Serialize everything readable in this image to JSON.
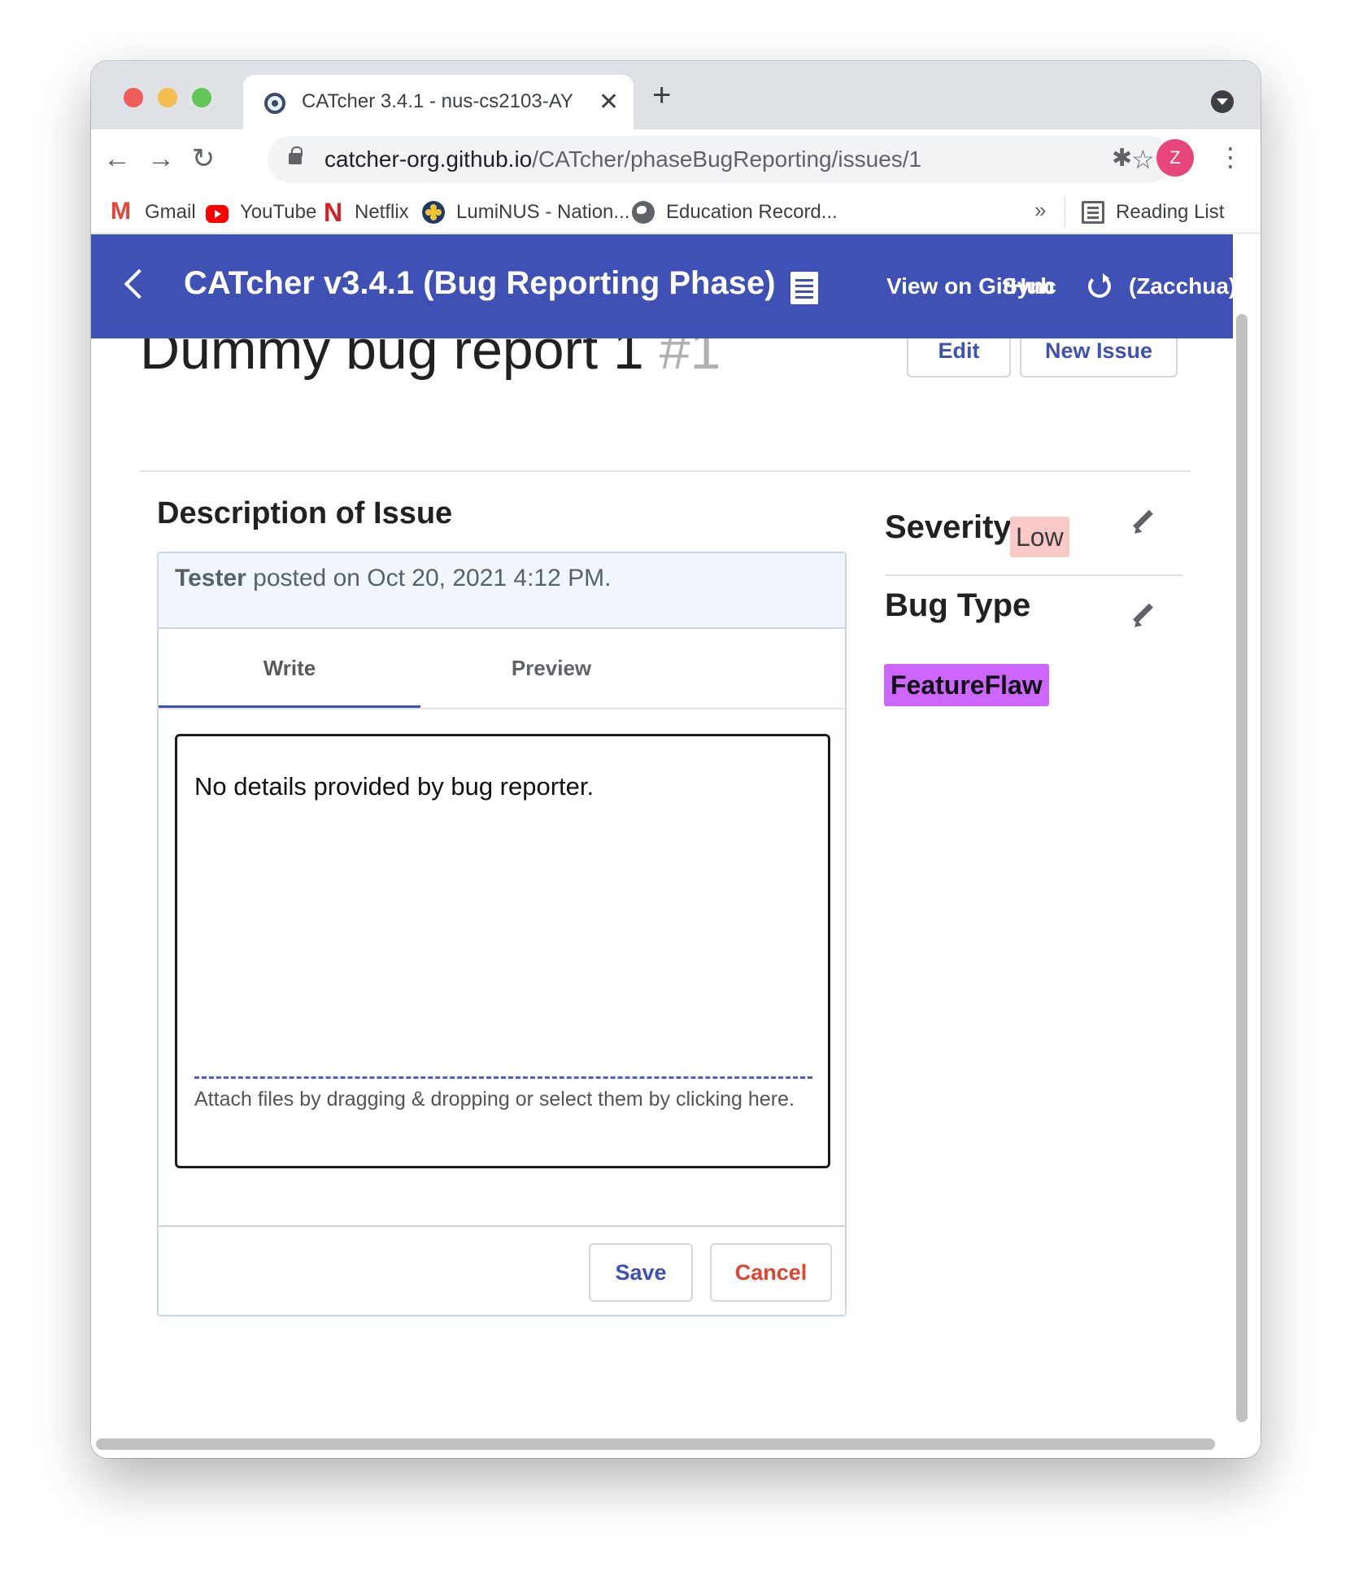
{
  "browser": {
    "tab_title": "CATcher 3.4.1 - nus-cs2103-AY",
    "tab_close": "✕",
    "new_tab": "+",
    "nav": {
      "back": "←",
      "forward": "→",
      "reload": "↻"
    },
    "url_host": "catcher-org.github.io",
    "url_path": "/CATcher/phaseBugReporting/issues/1",
    "star": "☆",
    "extensions": "✱",
    "avatar_letter": "Z",
    "menu": "⋮",
    "bookmarks": [
      {
        "label": "Gmail",
        "icon": "gmail-icon"
      },
      {
        "label": "YouTube",
        "icon": "youtube-icon"
      },
      {
        "label": "Netflix",
        "icon": "netflix-icon"
      },
      {
        "label": "LumiNUS - Nation...",
        "icon": "luminus-icon"
      },
      {
        "label": "Education Record...",
        "icon": "globe-icon"
      }
    ],
    "bookmarks_more": "»",
    "reading_list": "Reading List"
  },
  "app": {
    "title": "CATcher v3.4.1  (Bug Reporting Phase)",
    "view_on_github": "View on GitHub",
    "sync": "Sync",
    "user": "(Zacchua)",
    "primary_color": "#3f51b5"
  },
  "issue": {
    "title": "Dummy bug report 1",
    "number": "#1",
    "edit_label": "Edit",
    "new_issue_label": "New Issue",
    "description_heading": "Description of Issue",
    "comment": {
      "author": "Tester",
      "meta": " posted on Oct 20, 2021 4:12 PM."
    },
    "tabs": {
      "write": "Write",
      "preview": "Preview"
    },
    "editor_text": "No details provided by bug reporter.",
    "attach_hint": "Attach files by dragging & dropping or select them by clicking here.",
    "save_label": "Save",
    "cancel_label": "Cancel"
  },
  "sidebar": {
    "severity_label": "Severity",
    "severity_value": "Low",
    "severity_color": "#f8c9c6",
    "bug_type_label": "Bug Type",
    "bug_type_value": "FeatureFlaw",
    "bug_type_color": "#cc66ff"
  }
}
